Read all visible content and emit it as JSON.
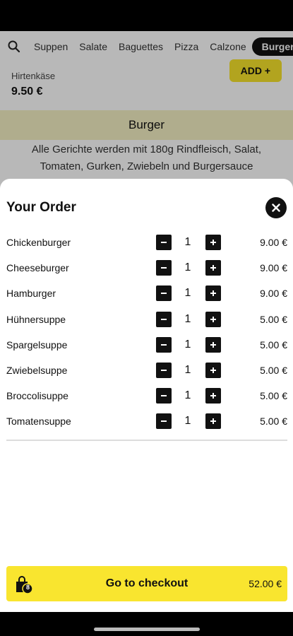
{
  "categories": [
    "Suppen",
    "Salate",
    "Baguettes",
    "Pizza",
    "Calzone",
    "Burger"
  ],
  "background_item": {
    "name": "Hirtenkäse",
    "price": "9.50 €",
    "add_label": "ADD +"
  },
  "section": {
    "title": "Burger",
    "description": "Alle Gerichte werden mit 180g Rindfleisch, Salat, Tomaten, Gurken, Zwiebeln und Burgersauce"
  },
  "order": {
    "title": "Your Order",
    "items": [
      {
        "name": "Chickenburger",
        "qty": "1",
        "price": "9.00 €"
      },
      {
        "name": "Cheeseburger",
        "qty": "1",
        "price": "9.00 €"
      },
      {
        "name": "Hamburger",
        "qty": "1",
        "price": "9.00 €"
      },
      {
        "name": "Hühnersuppe",
        "qty": "1",
        "price": "5.00 €"
      },
      {
        "name": "Spargelsuppe",
        "qty": "1",
        "price": "5.00 €"
      },
      {
        "name": "Zwiebelsuppe",
        "qty": "1",
        "price": "5.00 €"
      },
      {
        "name": "Broccolisuppe",
        "qty": "1",
        "price": "5.00 €"
      },
      {
        "name": "Tomatensuppe",
        "qty": "1",
        "price": "5.00 €"
      }
    ]
  },
  "checkout": {
    "label": "Go to checkout",
    "total": "52.00 €",
    "badge_count": "8"
  },
  "colors": {
    "accent": "#f9e52f",
    "dark": "#111111",
    "section_bg": "#f4f0c4"
  }
}
